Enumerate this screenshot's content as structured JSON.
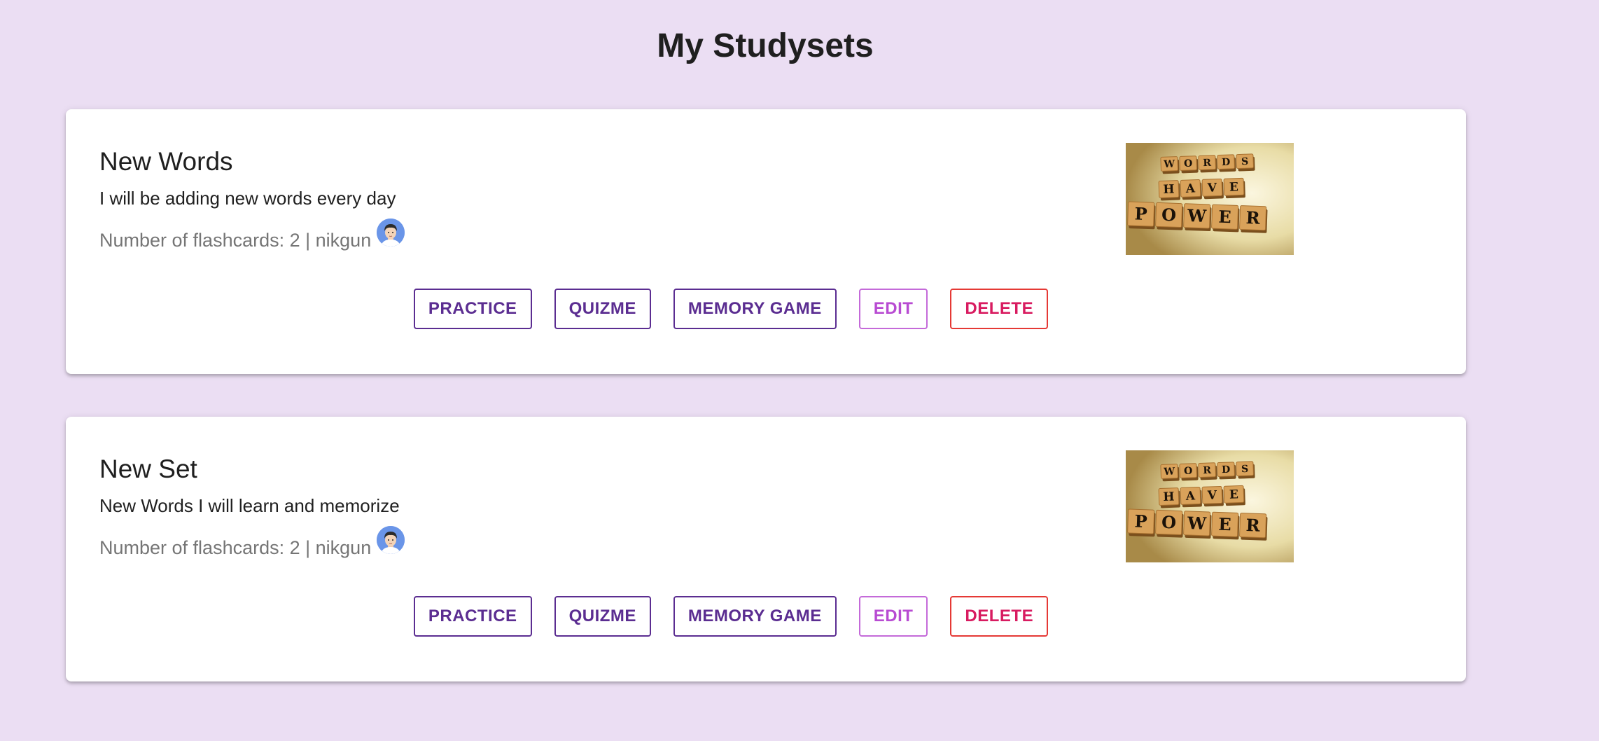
{
  "header": {
    "title": "My Studysets"
  },
  "studysets": [
    {
      "title": "New Words",
      "description": "I will be adding new words every day",
      "meta": "Number of flashcards: 2 | nikgun",
      "image_icon": "scrabble-tiles-words-have-power-image",
      "image_tiles": [
        "WORDS",
        "HAVE",
        "POWER"
      ],
      "buttons": {
        "practice": "PRACTICE",
        "quizme": "QUIZME",
        "memory_game": "MEMORY GAME",
        "edit": "EDIT",
        "delete": "DELETE"
      }
    },
    {
      "title": "New Set",
      "description": "New Words I will learn and memorize",
      "meta": "Number of flashcards: 2 | nikgun",
      "image_icon": "scrabble-tiles-words-have-power-image",
      "image_tiles": [
        "WORDS",
        "HAVE",
        "POWER"
      ],
      "buttons": {
        "practice": "PRACTICE",
        "quizme": "QUIZME",
        "memory_game": "MEMORY GAME",
        "edit": "EDIT",
        "delete": "DELETE"
      }
    }
  ],
  "colors": {
    "background": "#ebdef3",
    "primary_button": "#5b2d91",
    "edit_button": "#c46ad9",
    "delete_button": "#e53935",
    "avatar": "#6a95e8"
  }
}
